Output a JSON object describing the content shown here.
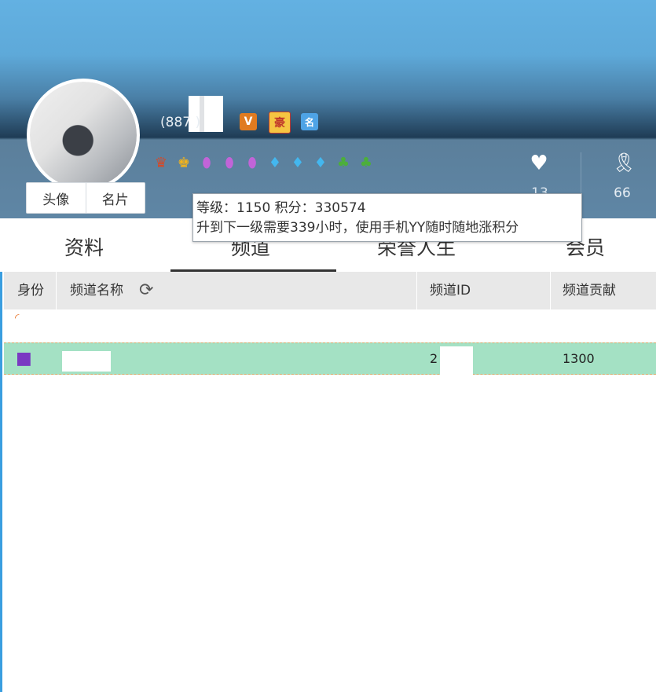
{
  "profile": {
    "uid_display": "(887   )",
    "avatar_label": "头像",
    "card_label": "名片",
    "badges": {
      "vip": "V",
      "hao": "豪",
      "card": "名"
    },
    "stats": {
      "likes": "13",
      "awards": "66"
    }
  },
  "tabs": [
    {
      "label": "资料"
    },
    {
      "label": "频道"
    },
    {
      "label": "荣誉人生"
    },
    {
      "label": "会员"
    }
  ],
  "tooltip": {
    "line1": "等级：1150 积分：330574",
    "line2": "升到下一级需要339小时，使用手机YY随时随地涨积分"
  },
  "table": {
    "headers": {
      "identity": "身份",
      "channel_name": "频道名称",
      "channel_id": "频道ID",
      "contribution": "频道贡献"
    },
    "rows": [
      {
        "channel_id": "2",
        "contribution": "1300"
      }
    ]
  },
  "colors": {
    "header_blue": "#5ea9d9",
    "selected_row": "#a4e1c4",
    "text": "#333333"
  }
}
